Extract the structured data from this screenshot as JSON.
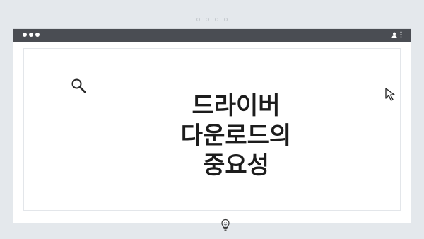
{
  "headline": "드라이버\n다운로드의\n중요성",
  "colors": {
    "page_background": "#e4e8ec",
    "titlebar": "#4a4d53",
    "frame": "#ffffff",
    "text": "#1c1c1c"
  },
  "icons": {
    "search": "search-icon",
    "cursor": "cursor-arrow-icon",
    "bulb": "lightbulb-icon",
    "user": "user-icon",
    "menu": "kebab-menu-icon"
  }
}
